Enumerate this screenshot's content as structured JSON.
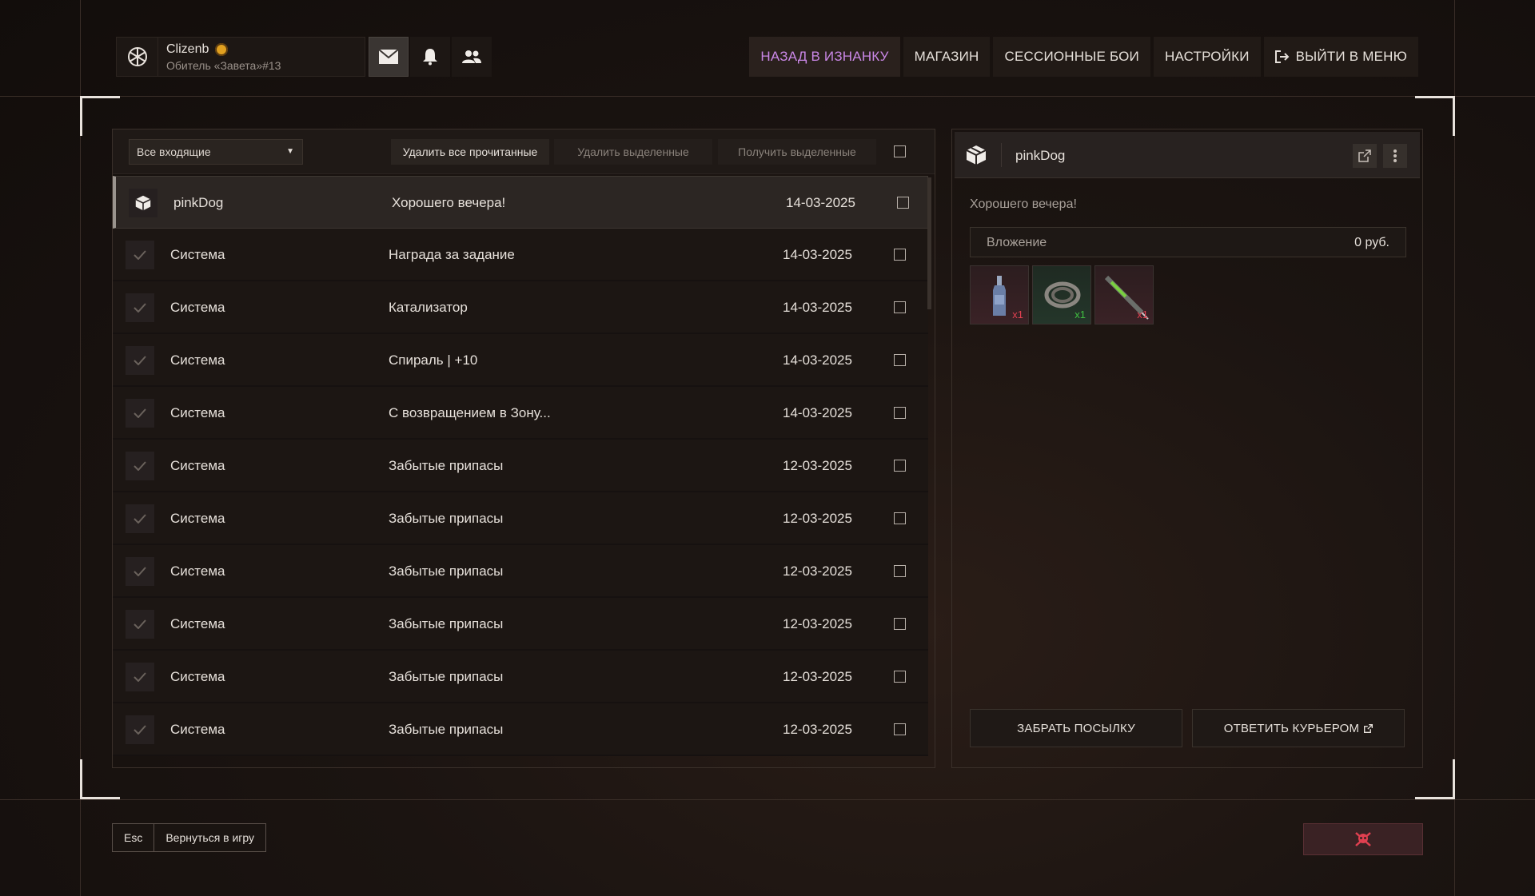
{
  "profile": {
    "name": "Clizenb",
    "title": "Обитель «Завета»#13"
  },
  "nav": {
    "back": "НАЗАД В ИЗНАНКУ",
    "shop": "МАГАЗИН",
    "battles": "СЕССИОННЫЕ БОИ",
    "settings": "НАСТРОЙКИ",
    "exit": "ВЫЙТИ В МЕНЮ"
  },
  "toolbar": {
    "filter": "Все входящие",
    "delete_read": "Удалить все прочитанные",
    "delete_selected": "Удалить выделенные",
    "get_selected": "Получить выделенные"
  },
  "messages": [
    {
      "from": "pinkDog",
      "subject": "Хорошего вечера!",
      "date": "14-03-2025"
    },
    {
      "from": "Система",
      "subject": "Награда за задание",
      "date": "14-03-2025"
    },
    {
      "from": "Система",
      "subject": "Катализатор",
      "date": "14-03-2025"
    },
    {
      "from": "Система",
      "subject": "Спираль | +10",
      "date": "14-03-2025"
    },
    {
      "from": "Система",
      "subject": "С возвращением в Зону...",
      "date": "14-03-2025"
    },
    {
      "from": "Система",
      "subject": "Забытые припасы",
      "date": "12-03-2025"
    },
    {
      "from": "Система",
      "subject": "Забытые припасы",
      "date": "12-03-2025"
    },
    {
      "from": "Система",
      "subject": "Забытые припасы",
      "date": "12-03-2025"
    },
    {
      "from": "Система",
      "subject": "Забытые припасы",
      "date": "12-03-2025"
    },
    {
      "from": "Система",
      "subject": "Забытые припасы",
      "date": "12-03-2025"
    },
    {
      "from": "Система",
      "subject": "Забытые припасы",
      "date": "12-03-2025"
    }
  ],
  "detail": {
    "sender": "pinkDog",
    "text": "Хорошего вечера!",
    "attachment_label": "Вложение",
    "attachment_value": "0 руб.",
    "items": [
      {
        "name": "bottle-item",
        "qty": "x1",
        "qty_color": "#e04050"
      },
      {
        "name": "rope-item",
        "qty": "x1",
        "qty_color": "#40c040"
      },
      {
        "name": "syringe-item",
        "qty": "x1",
        "qty_color": "#e04050"
      }
    ],
    "take_button": "ЗАБРАТЬ ПОСЫЛКУ",
    "reply_button": "ОТВЕТИТЬ КУРЬЕРОМ"
  },
  "footer": {
    "esc_key": "Esc",
    "return_label": "Вернуться в игру"
  },
  "colors": {
    "accent": "#c987e6",
    "danger": "#e04050"
  }
}
